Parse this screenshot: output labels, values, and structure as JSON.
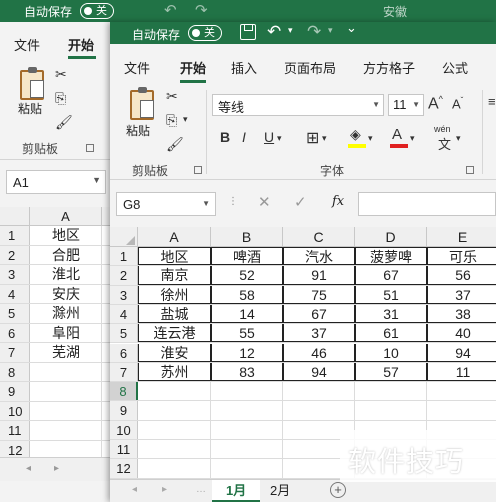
{
  "back_window": {
    "autosave_label": "自动保存",
    "toggle_label": "关",
    "file_title": "安徽",
    "tabs": [
      "文件",
      "开始"
    ],
    "paste_label": "粘贴",
    "clipboard_group": "剪贴板",
    "name_box": "A1",
    "col_a": "A",
    "rows": [
      {
        "num": "1",
        "value": "地区"
      },
      {
        "num": "2",
        "value": "合肥"
      },
      {
        "num": "3",
        "value": "淮北"
      },
      {
        "num": "4",
        "value": "安庆"
      },
      {
        "num": "5",
        "value": "滁州"
      },
      {
        "num": "6",
        "value": "阜阳"
      },
      {
        "num": "7",
        "value": "芜湖"
      },
      {
        "num": "8",
        "value": ""
      },
      {
        "num": "9",
        "value": ""
      },
      {
        "num": "10",
        "value": ""
      },
      {
        "num": "11",
        "value": ""
      },
      {
        "num": "12",
        "value": ""
      }
    ]
  },
  "front_window": {
    "autosave_label": "自动保存",
    "toggle_label": "关",
    "tabs": [
      "文件",
      "开始",
      "插入",
      "页面布局",
      "方方格子",
      "公式"
    ],
    "paste_label": "粘贴",
    "clipboard_group": "剪贴板",
    "font_group": "字体",
    "font_name": "等线",
    "font_size": "11",
    "grow_font": "A^",
    "shrink_font": "A",
    "bold": "B",
    "italic": "I",
    "underline": "U",
    "font_color_glyph": "A",
    "wen_label": "wén",
    "name_box": "G8",
    "fx_label": "fx",
    "columns": [
      "A",
      "B",
      "C",
      "D",
      "E"
    ],
    "table": [
      [
        "地区",
        "啤酒",
        "汽水",
        "菠萝啤",
        "可乐"
      ],
      [
        "南京",
        "52",
        "91",
        "67",
        "56"
      ],
      [
        "徐州",
        "58",
        "75",
        "51",
        "37"
      ],
      [
        "盐城",
        "14",
        "67",
        "31",
        "38"
      ],
      [
        "连云港",
        "55",
        "37",
        "61",
        "40"
      ],
      [
        "淮安",
        "12",
        "46",
        "10",
        "94"
      ],
      [
        "苏州",
        "83",
        "94",
        "57",
        "11"
      ]
    ],
    "row_numbers": [
      "1",
      "2",
      "3",
      "4",
      "5",
      "6",
      "7",
      "8",
      "9",
      "10",
      "11",
      "12"
    ],
    "sheets": [
      "1月",
      "2月"
    ],
    "add_sheet": "+"
  },
  "watermark": "软件技巧",
  "colors": {
    "excel_green": "#217346",
    "ribbon_bg": "#f3f3f3"
  }
}
